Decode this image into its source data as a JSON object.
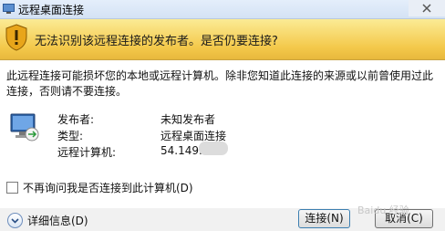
{
  "window": {
    "title": "远程桌面连接"
  },
  "banner": {
    "text": "无法识别该远程连接的发布者。是否仍要连接?"
  },
  "warning": {
    "text": "此远程连接可能损坏您的本地或远程计算机。除非您知道此连接的来源或以前曾使用过此连接，否则请不要连接。"
  },
  "info": [
    {
      "label": "发布者:",
      "value": "未知发布者"
    },
    {
      "label": "类型:",
      "value": "远程桌面连接"
    },
    {
      "label": "远程计算机:",
      "value": "54.149."
    }
  ],
  "options": {
    "dont_ask_label": "不再询问我是否连接到此计算机(D)",
    "dont_ask_checked": false
  },
  "footer": {
    "details_label": "详细信息(D)",
    "connect_label": "连接(N)",
    "cancel_label": "取消(C)"
  },
  "watermark": "Baidu 经验",
  "colors": {
    "banner": "#f4c94b",
    "titlebar": "#dce8f8",
    "content": "#ffffff"
  }
}
